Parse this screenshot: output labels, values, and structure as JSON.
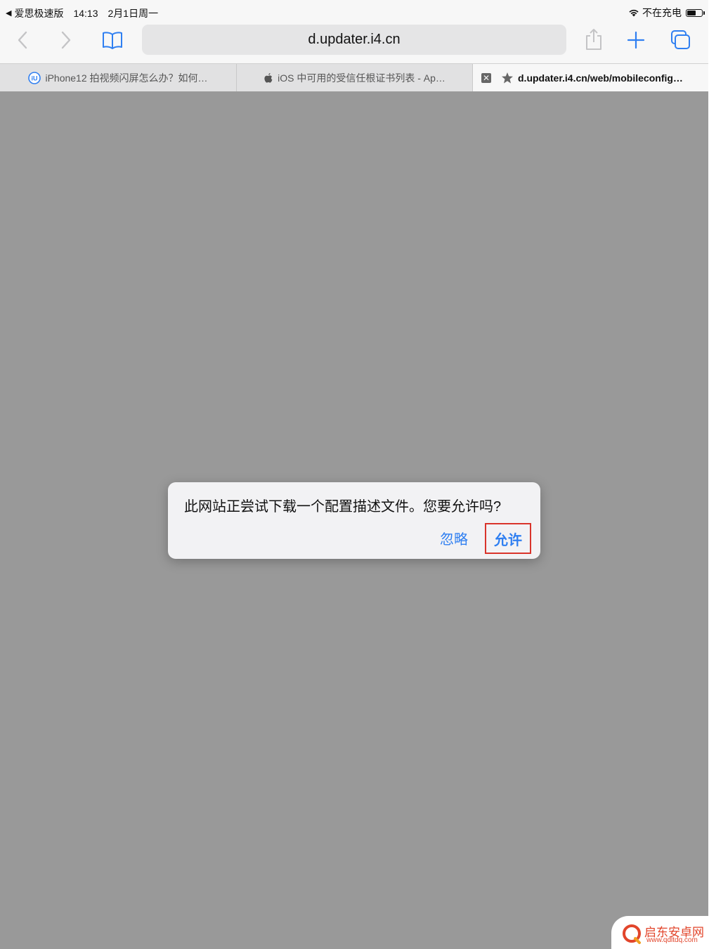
{
  "status_bar": {
    "back_app": "爱思极速版",
    "time": "14:13",
    "date": "2月1日周一",
    "charging_status": "不在充电",
    "battery_level": 0.55
  },
  "toolbar": {
    "url": "d.updater.i4.cn",
    "icons": [
      "back-icon",
      "forward-icon",
      "bookmarks-icon",
      "share-icon",
      "new-tab-icon",
      "tabs-overview-icon"
    ]
  },
  "tabs": [
    {
      "title": "iPhone12 拍视频闪屏怎么办？如何…",
      "favicon": "i4-icon",
      "active": false
    },
    {
      "title": "iOS 中可用的受信任根证书列表 - Ap…",
      "favicon": "apple-icon",
      "active": false
    },
    {
      "title": "d.updater.i4.cn/web/mobileconfig…",
      "favicon": "star-icon",
      "active": true
    }
  ],
  "alert": {
    "message": "此网站正尝试下载一个配置描述文件。您要允许吗?",
    "ignore_label": "忽略",
    "allow_label": "允许"
  },
  "watermark": {
    "title": "启东安卓网",
    "url": "www.qdltdq.com"
  },
  "colors": {
    "accent": "#2f7ff1",
    "highlight_border": "#d9342b",
    "overlay": "#999999",
    "watermark": "#e2452b"
  }
}
